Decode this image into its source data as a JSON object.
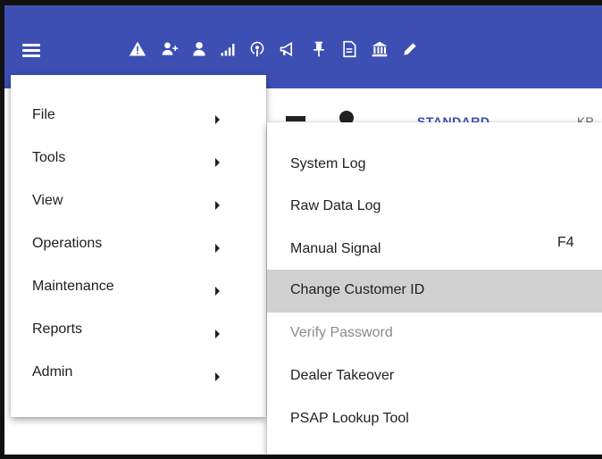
{
  "toolbar": {
    "icons": [
      "menu-icon",
      "warning-icon",
      "add-user-icon",
      "user-icon",
      "signal-icon",
      "podcast-icon",
      "megaphone-icon",
      "pin-icon",
      "document-icon",
      "bank-icon",
      "pencil-icon"
    ],
    "color": "#3d4fb3"
  },
  "background": {
    "tab1": "STANDARD",
    "tab2": "KP"
  },
  "menu": {
    "items": [
      {
        "label": "File"
      },
      {
        "label": "Tools"
      },
      {
        "label": "View"
      },
      {
        "label": "Operations"
      },
      {
        "label": "Maintenance"
      },
      {
        "label": "Reports"
      },
      {
        "label": "Admin"
      }
    ]
  },
  "submenu": {
    "items": [
      {
        "label": "System Log",
        "shortcut": "",
        "state": "normal"
      },
      {
        "label": "Raw Data Log",
        "shortcut": "",
        "state": "normal"
      },
      {
        "label": "Manual Signal",
        "shortcut": "F4",
        "state": "normal"
      },
      {
        "label": "Change Customer ID",
        "shortcut": "",
        "state": "highlighted"
      },
      {
        "label": "Verify Password",
        "shortcut": "",
        "state": "disabled"
      },
      {
        "label": "Dealer Takeover",
        "shortcut": "",
        "state": "normal"
      },
      {
        "label": "PSAP Lookup Tool",
        "shortcut": "",
        "state": "normal"
      }
    ],
    "highlight_color": "#d0d0d0"
  }
}
